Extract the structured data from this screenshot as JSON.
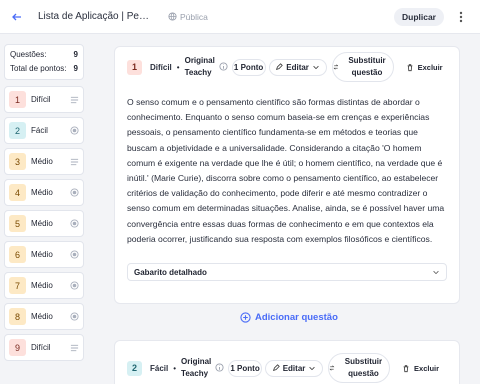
{
  "header": {
    "title": "Lista de Aplicação | Pensamento Científico",
    "visibility": "Pública",
    "duplicate_label": "Duplicar"
  },
  "sidebar": {
    "summary": [
      {
        "label": "Questões:",
        "value": "9"
      },
      {
        "label": "Total de pontos:",
        "value": "9"
      }
    ],
    "items": [
      {
        "num": "1",
        "label": "Difícil",
        "level": "hard",
        "icon": "lines-icon"
      },
      {
        "num": "2",
        "label": "Fácil",
        "level": "easy",
        "icon": "radio-icon"
      },
      {
        "num": "3",
        "label": "Médio",
        "level": "medium",
        "icon": "lines-icon"
      },
      {
        "num": "4",
        "label": "Médio",
        "level": "medium",
        "icon": "radio-icon"
      },
      {
        "num": "5",
        "label": "Médio",
        "level": "medium",
        "icon": "radio-icon"
      },
      {
        "num": "6",
        "label": "Médio",
        "level": "medium",
        "icon": "radio-icon"
      },
      {
        "num": "7",
        "label": "Médio",
        "level": "medium",
        "icon": "radio-icon"
      },
      {
        "num": "8",
        "label": "Médio",
        "level": "medium",
        "icon": "radio-icon"
      },
      {
        "num": "9",
        "label": "Difícil",
        "level": "hard",
        "icon": "lines-icon"
      }
    ]
  },
  "questions": [
    {
      "num": "1",
      "difficulty": "Difícil",
      "origin": "Original Teachy",
      "points": "1 Ponto",
      "edit_label": "Editar",
      "substitute_label": "Substituir questão",
      "delete_label": "Excluir",
      "text": "O senso comum e o pensamento científico são formas distintas de abordar o conhecimento. Enquanto o senso comum baseia-se em crenças e experiências pessoais, o pensamento científico fundamenta-se em métodos e teorias que buscam a objetividade e a universalidade. Considerando a citação 'O homem comum é exigente na verdade que lhe é útil; o homem científico, na verdade que é inútil.' (Marie Curie), discorra sobre como o pensamento científico, ao estabelecer critérios de validação do conhecimento, pode diferir e até mesmo contradizer o senso comum em determinadas situações. Analise, ainda, se é possível haver uma convergência entre essas duas formas de conhecimento e em que contextos ela poderia ocorrer, justificando sua resposta com exemplos filosóficos e científicos.",
      "answer_key_label": "Gabarito detalhado"
    },
    {
      "num": "2",
      "difficulty": "Fácil",
      "origin": "Original Teachy",
      "points": "1 Ponto",
      "edit_label": "Editar",
      "substitute_label": "Substituir questão",
      "delete_label": "Excluir"
    }
  ],
  "add_question_label": "Adicionar questão",
  "colors": {
    "accent": "#4a6cf7",
    "hard": "#fde0dc",
    "medium": "#fde9c5",
    "easy": "#d6f0f3"
  }
}
